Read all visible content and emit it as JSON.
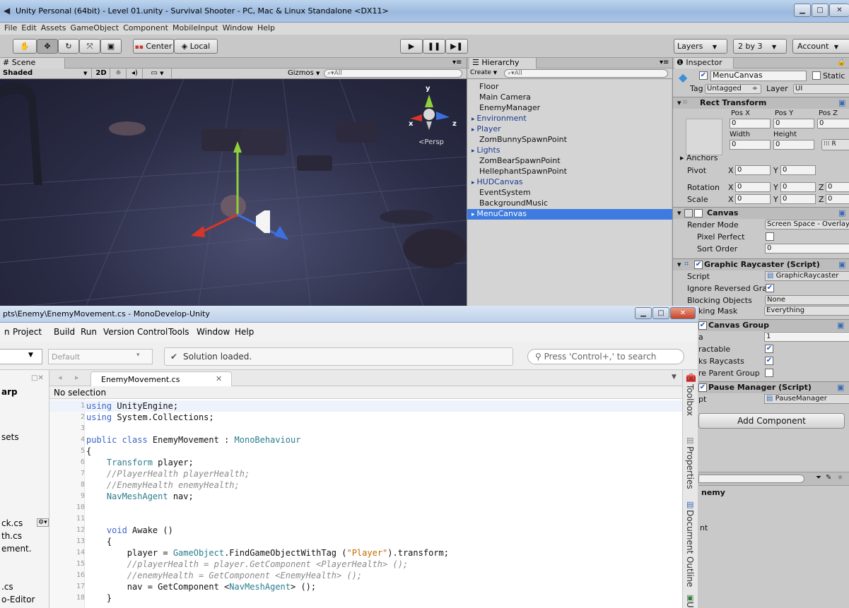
{
  "unity": {
    "window_title": "Unity Personal (64bit) - Level 01.unity - Survival Shooter - PC, Mac & Linux Standalone <DX11>",
    "menu": [
      "File",
      "Edit",
      "Assets",
      "GameObject",
      "Component",
      "MobileInput",
      "Window",
      "Help"
    ],
    "toolbar": {
      "center": "Center",
      "local": "Local",
      "layers": "Layers",
      "layout": "2 by 3",
      "account": "Account"
    },
    "scene": {
      "tab": "Scene",
      "shading": "Shaded",
      "mode_2d": "2D",
      "gizmos": "Gizmos",
      "search_placeholder": "All",
      "persp": "Persp",
      "axes": {
        "y": "y",
        "x": "x",
        "z": "z"
      }
    },
    "hierarchy": {
      "tab": "Hierarchy",
      "create": "Create",
      "search_placeholder": "All",
      "items": [
        {
          "label": "Floor",
          "foldout": false
        },
        {
          "label": "Main Camera",
          "foldout": false
        },
        {
          "label": "EnemyManager",
          "foldout": false
        },
        {
          "label": "Environment",
          "foldout": true
        },
        {
          "label": "Player",
          "foldout": true
        },
        {
          "label": "ZomBunnySpawnPoint",
          "foldout": false
        },
        {
          "label": "Lights",
          "foldout": true
        },
        {
          "label": "ZomBearSpawnPoint",
          "foldout": false
        },
        {
          "label": "HellephantSpawnPoint",
          "foldout": false
        },
        {
          "label": "HUDCanvas",
          "foldout": true
        },
        {
          "label": "EventSystem",
          "foldout": false
        },
        {
          "label": "BackgroundMusic",
          "foldout": false
        },
        {
          "label": "MenuCanvas",
          "foldout": true,
          "selected": true
        }
      ]
    },
    "inspector": {
      "tab": "Inspector",
      "object_name": "MenuCanvas",
      "static": "Static",
      "tag_label": "Tag",
      "tag_value": "Untagged",
      "layer_label": "Layer",
      "layer_value": "UI",
      "rect": {
        "title": "Rect Transform",
        "pos_x": "Pos X",
        "pos_y": "Pos Y",
        "pos_z": "Pos Z",
        "px": "0",
        "py": "0",
        "pz": "0",
        "width": "Width",
        "height": "Height",
        "w": "0",
        "h": "0",
        "anchors": "Anchors",
        "pivot": "Pivot",
        "pivot_x": "0",
        "pivot_y": "0",
        "rotation": "Rotation",
        "rot_x": "0",
        "rot_y": "0",
        "rot_z": "0",
        "scale": "Scale",
        "sc_x": "0",
        "sc_y": "0",
        "sc_z": "0",
        "x": "X",
        "y": "Y",
        "z": "Z"
      },
      "canvas": {
        "title": "Canvas",
        "render_mode": "Render Mode",
        "render_mode_value": "Screen Space - Overlay",
        "pixel_perfect": "Pixel Perfect",
        "sort_order": "Sort Order",
        "sort_order_value": "0"
      },
      "raycaster": {
        "title": "Graphic Raycaster (Script)",
        "script": "Script",
        "script_value": "GraphicRaycaster",
        "ignore": "Ignore Reversed Gra",
        "blocking": "Blocking Objects",
        "blocking_value": "None",
        "mask": "king Mask",
        "mask_value": "Everything"
      },
      "canvas_group": {
        "title": "Canvas Group",
        "alpha": "a",
        "alpha_value": "1",
        "interactable": "ractable",
        "blocks": "ks Raycasts",
        "ignore_parent": "re Parent Group"
      },
      "pause": {
        "title": "Pause Manager (Script)",
        "script": "pt",
        "script_value": "PauseManager"
      },
      "add_component": "Add Component",
      "lower_label": "nemy",
      "lower_label2": "nt"
    }
  },
  "mono": {
    "title": "pts\\Enemy\\EnemyMovement.cs - MonoDevelop-Unity",
    "menu": [
      "n",
      "Project",
      "Build",
      "Run",
      "Version Control",
      "Tools",
      "Window",
      "Help"
    ],
    "config": "Default",
    "status": "Solution loaded.",
    "search_placeholder": "Press 'Control+,' to search",
    "tab": "EnemyMovement.cs",
    "no_selection": "No selection",
    "left_items": [
      {
        "label": "arp",
        "bold": true
      },
      {
        "label": "sets",
        "bold": false
      },
      {
        "label": "ck.cs",
        "bold": false
      },
      {
        "label": "th.cs",
        "bold": false
      },
      {
        "label": "ement.",
        "bold": false
      },
      {
        "label": ".cs",
        "bold": false
      },
      {
        "label": "o-Editor",
        "bold": false
      }
    ],
    "dock": [
      "Toolbox",
      "Properties",
      "Document Outline",
      "U"
    ],
    "code": [
      {
        "n": "1",
        "t": [
          {
            "c": "kw",
            "s": "using"
          },
          {
            "c": "",
            "s": " UnityEngine;"
          }
        ]
      },
      {
        "n": "2",
        "t": [
          {
            "c": "kw",
            "s": "using"
          },
          {
            "c": "",
            "s": " System.Collections;"
          }
        ]
      },
      {
        "n": "3",
        "t": []
      },
      {
        "n": "4",
        "t": [
          {
            "c": "kw",
            "s": "public class"
          },
          {
            "c": "",
            "s": " EnemyMovement : "
          },
          {
            "c": "ty",
            "s": "MonoBehaviour"
          }
        ]
      },
      {
        "n": "5",
        "t": [
          {
            "c": "",
            "s": "{"
          }
        ]
      },
      {
        "n": "6",
        "t": [
          {
            "c": "",
            "s": "    "
          },
          {
            "c": "ty",
            "s": "Transform"
          },
          {
            "c": "",
            "s": " player;"
          }
        ]
      },
      {
        "n": "7",
        "t": [
          {
            "c": "cm",
            "s": "    //PlayerHealth playerHealth;"
          }
        ]
      },
      {
        "n": "8",
        "t": [
          {
            "c": "cm",
            "s": "    //EnemyHealth enemyHealth;"
          }
        ]
      },
      {
        "n": "9",
        "t": [
          {
            "c": "",
            "s": "    "
          },
          {
            "c": "ty",
            "s": "NavMeshAgent"
          },
          {
            "c": "",
            "s": " nav;"
          }
        ]
      },
      {
        "n": "10",
        "t": []
      },
      {
        "n": "11",
        "t": []
      },
      {
        "n": "12",
        "t": [
          {
            "c": "",
            "s": "    "
          },
          {
            "c": "kw",
            "s": "void"
          },
          {
            "c": "",
            "s": " Awake ()"
          }
        ]
      },
      {
        "n": "13",
        "t": [
          {
            "c": "",
            "s": "    {"
          }
        ]
      },
      {
        "n": "14",
        "t": [
          {
            "c": "",
            "s": "        player = "
          },
          {
            "c": "ty",
            "s": "GameObject"
          },
          {
            "c": "",
            "s": ".FindGameObjectWithTag ("
          },
          {
            "c": "st",
            "s": "\"Player\""
          },
          {
            "c": "",
            "s": ").transform;"
          }
        ]
      },
      {
        "n": "15",
        "t": [
          {
            "c": "cm",
            "s": "        //playerHealth = player.GetComponent <PlayerHealth> ();"
          }
        ]
      },
      {
        "n": "16",
        "t": [
          {
            "c": "cm",
            "s": "        //enemyHealth = GetComponent <EnemyHealth> ();"
          }
        ]
      },
      {
        "n": "17",
        "t": [
          {
            "c": "",
            "s": "        nav = GetComponent <"
          },
          {
            "c": "ty",
            "s": "NavMeshAgent"
          },
          {
            "c": "",
            "s": "> ();"
          }
        ]
      },
      {
        "n": "18",
        "t": [
          {
            "c": "",
            "s": "    }"
          }
        ]
      }
    ]
  }
}
